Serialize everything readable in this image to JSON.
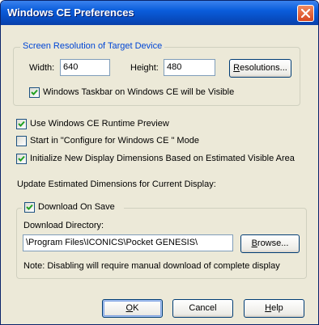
{
  "window": {
    "title": "Windows CE Preferences"
  },
  "resolution_group": {
    "legend": "Screen Resolution of Target Device",
    "width_label": "Width:",
    "width_value": "640",
    "height_label": "Height:",
    "height_value": "480",
    "resolutions_button": {
      "prefix": "",
      "mnemonic": "R",
      "rest": "esolutions..."
    },
    "taskbar_checkbox": {
      "label": "Windows Taskbar on Windows CE will be Visible",
      "checked": true
    }
  },
  "options": [
    {
      "label": "Use Windows CE Runtime Preview",
      "checked": true
    },
    {
      "label": "Start in \"Configure for Windows CE \" Mode",
      "checked": false
    },
    {
      "label": "Initialize New Display Dimensions Based on Estimated Visible Area",
      "checked": true
    }
  ],
  "update_text": "Update Estimated Dimensions for Current Display:",
  "download_group": {
    "download_checkbox": {
      "label": "Download On Save",
      "checked": true
    },
    "directory_label": "Download Directory:",
    "directory_value": "\\Program Files\\ICONICS\\Pocket GENESIS\\",
    "browse_button": {
      "prefix": "",
      "mnemonic": "B",
      "rest": "rowse..."
    },
    "note": "Note: Disabling will require manual download of complete display"
  },
  "buttons": {
    "ok": {
      "prefix": "",
      "mnemonic": "O",
      "rest": "K"
    },
    "cancel": {
      "label": "Cancel"
    },
    "help": {
      "prefix": "",
      "mnemonic": "H",
      "rest": "elp"
    }
  },
  "colors": {
    "titlebar": "#0a5ddb",
    "legend": "#0046d5",
    "dialog_bg": "#ece9d8",
    "close_button": "#d7461f"
  }
}
